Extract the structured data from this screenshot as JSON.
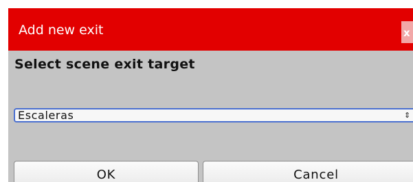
{
  "dialog": {
    "title": "Add new exit",
    "close_label": "x",
    "heading": "Select scene exit target",
    "target_select": {
      "value": "Escaleras",
      "arrows": "⇕"
    },
    "buttons": {
      "ok": "OK",
      "cancel": "Cancel"
    }
  },
  "colors": {
    "titlebar": "#e20000",
    "body": "#c4c4c4",
    "select_border": "#4a6fd0"
  }
}
